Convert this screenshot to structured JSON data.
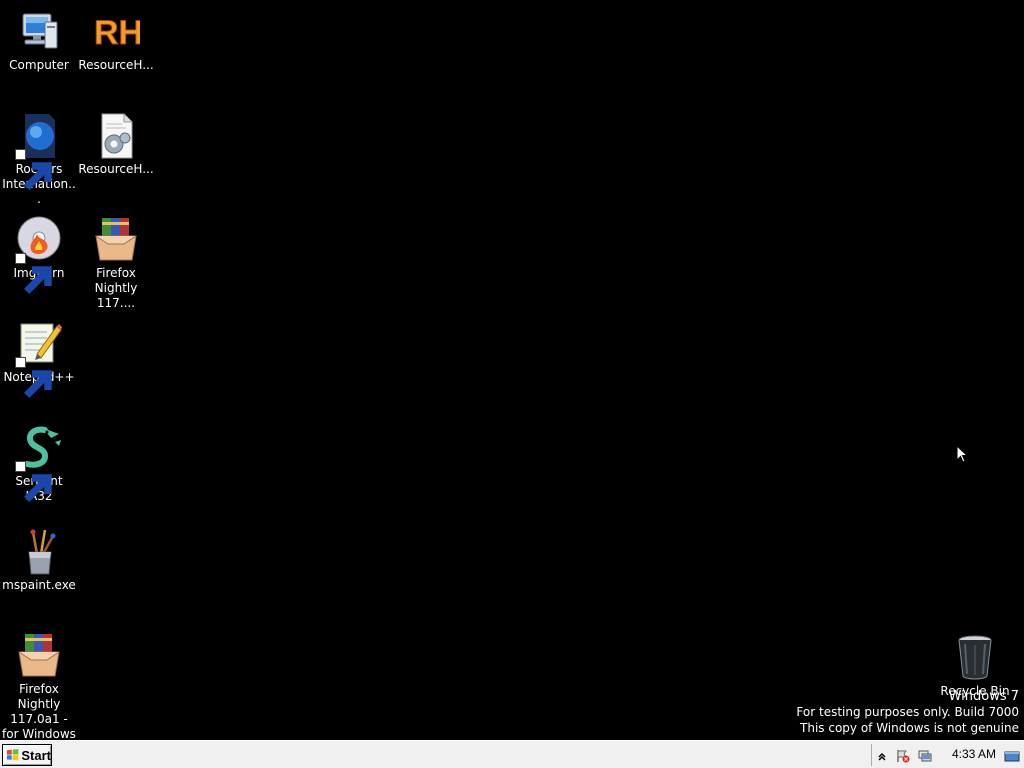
{
  "desktop": {
    "icons": [
      {
        "label": "Computer",
        "icon": "computer-icon"
      },
      {
        "label": "ResourceH...",
        "icon": "resource-hacker-icon"
      },
      {
        "label": "Rockers Internation...",
        "icon": "rockers-international-icon"
      },
      {
        "label": "ResourceH...",
        "icon": "resource-hacker-config-icon"
      },
      {
        "label": "ImgBurn",
        "icon": "imgburn-icon"
      },
      {
        "label": "Firefox Nightly 117....",
        "icon": "winrar-archive-icon"
      },
      {
        "label": "Notepad++",
        "icon": "notepad-plus-plus-icon"
      },
      {
        "label": "Serpent IA32",
        "icon": "serpent-ia32-icon"
      },
      {
        "label": "mspaint.exe",
        "icon": "mspaint-icon"
      },
      {
        "label": "Firefox Nightly 117.0a1 - for Windows 7",
        "icon": "winrar-archive-icon"
      },
      {
        "label": "Recycle Bin",
        "icon": "recycle-bin-icon"
      }
    ]
  },
  "watermark": {
    "title": "Windows 7",
    "line1": "For testing purposes only. Build 7000",
    "line2": "This copy of Windows is not genuine"
  },
  "taskbar": {
    "start_label": "Start",
    "clock": "4:33 AM",
    "tray_icons": [
      "show-hidden-icons-chevron-icon",
      "action-center-flag-icon",
      "network-icon",
      "show-desktop-icon"
    ]
  },
  "colors": {
    "desktop_background": "#000000",
    "taskbar_background": "#f0f0f0",
    "label_text": "#ffffff"
  }
}
